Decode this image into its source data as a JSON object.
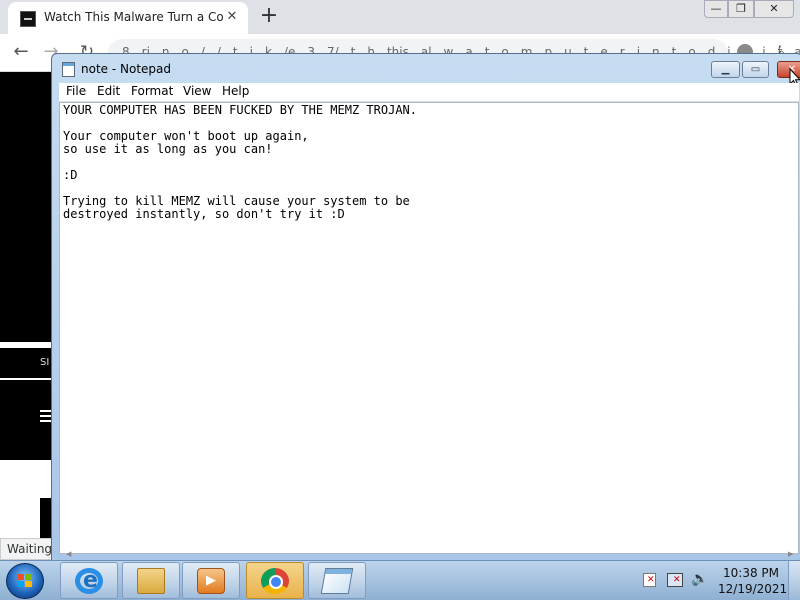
{
  "browser": {
    "tab_title": "Watch This Malware Turn a Comp",
    "tab_close": "✕",
    "new_tab": "+",
    "omnibox_text": "8…ri…n…o…/…/…t…i…k…/e…3…7/…t…h…this…al…w…a…t…o…m…p…u…t…e…r…i…n…t…o…d…i…g…i…t…a…l…",
    "status_text": "Waiting",
    "page_sidebar_text": "SI"
  },
  "notepad": {
    "title": "note - Notepad",
    "menu": {
      "file": "File",
      "edit": "Edit",
      "format": "Format",
      "view": "View",
      "help": "Help"
    },
    "content": "YOUR COMPUTER HAS BEEN FUCKED BY THE MEMZ TROJAN.\n\nYour computer won't boot up again,\nso use it as long as you can!\n\n:D\n\nTrying to kill MEMZ will cause your system to be\ndestroyed instantly, so don't try it :D"
  },
  "taskbar": {
    "time": "10:38 PM",
    "date": "12/19/2021",
    "pinned": [
      "internet-explorer-icon",
      "windows-explorer-icon",
      "media-player-icon",
      "chrome-icon",
      "notepad-icon"
    ]
  },
  "colors": {
    "notepad_frame": "#c6dcf1",
    "taskbar": "#bcd3ea",
    "close_red": "#c7432c",
    "active_task": "#f3d58c"
  }
}
